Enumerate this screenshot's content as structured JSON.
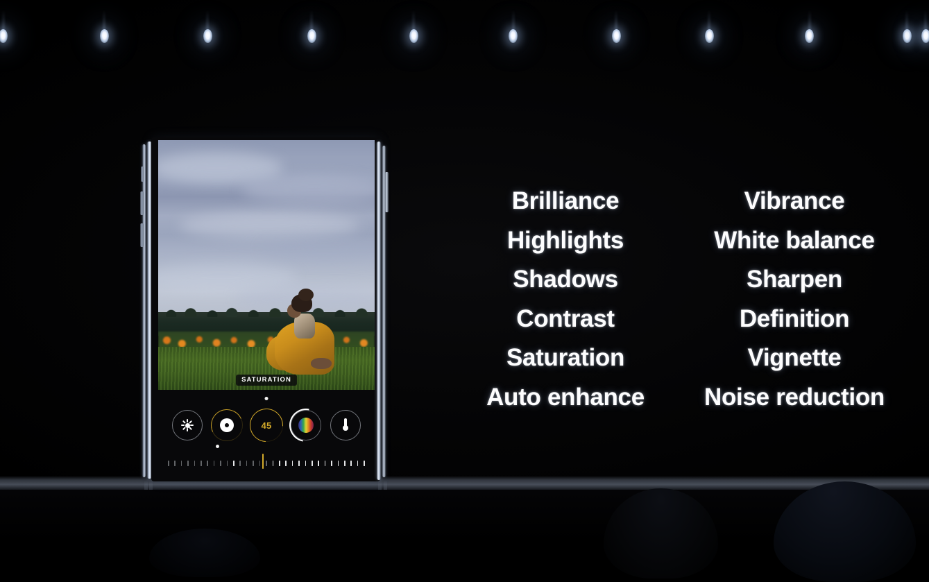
{
  "scene": {
    "venue": "keynote-stage",
    "background_color": "#000000",
    "stage_lights_count": 11,
    "stage_light_positions_pct": [
      0.3,
      11.2,
      22.3,
      33.5,
      44.5,
      55.2,
      66.3,
      76.3,
      87.1,
      97.6,
      99.6
    ]
  },
  "device": {
    "kind": "smartphone",
    "orientation": "portrait",
    "app": "photos-editor",
    "screen": {
      "photo": {
        "description": "Person in golden draped clothing sitting in a grass field with marigold flowers and a palm treeline under an overcast sky",
        "badge_label": "SATURATION"
      },
      "toolbar": {
        "tools": [
          {
            "name": "auto-enhance",
            "icon": "sun-burst-icon",
            "selected": false,
            "ring": "none",
            "value": null
          },
          {
            "name": "exposure",
            "icon": "exposure-dot-icon",
            "selected": false,
            "ring": "gold-partial",
            "value": null
          },
          {
            "name": "saturation",
            "icon": "value-number",
            "selected": true,
            "ring": "gold-selected",
            "value": "45"
          },
          {
            "name": "color",
            "icon": "spectrum-icon",
            "selected": false,
            "ring": "white-partial",
            "value": null
          },
          {
            "name": "white-balance",
            "icon": "thermometer-icon",
            "selected": false,
            "ring": "none",
            "value": null
          }
        ],
        "slider": {
          "tick_count": 31,
          "marker_position_pct": 48.2,
          "bright_tick_indices": [
            10,
            16,
            17,
            18,
            19,
            20,
            21,
            22,
            23,
            24,
            25,
            26,
            27,
            28,
            29,
            30
          ]
        },
        "accent_color": "#d4aa2a"
      }
    }
  },
  "adjustment_lists": {
    "left_column": [
      "Brilliance",
      "Highlights",
      "Shadows",
      "Contrast",
      "Saturation",
      "Auto enhance"
    ],
    "right_column": [
      "Vibrance",
      "White balance",
      "Sharpen",
      "Definition",
      "Vignette",
      "Noise reduction"
    ],
    "text_color": "#ffffff"
  }
}
